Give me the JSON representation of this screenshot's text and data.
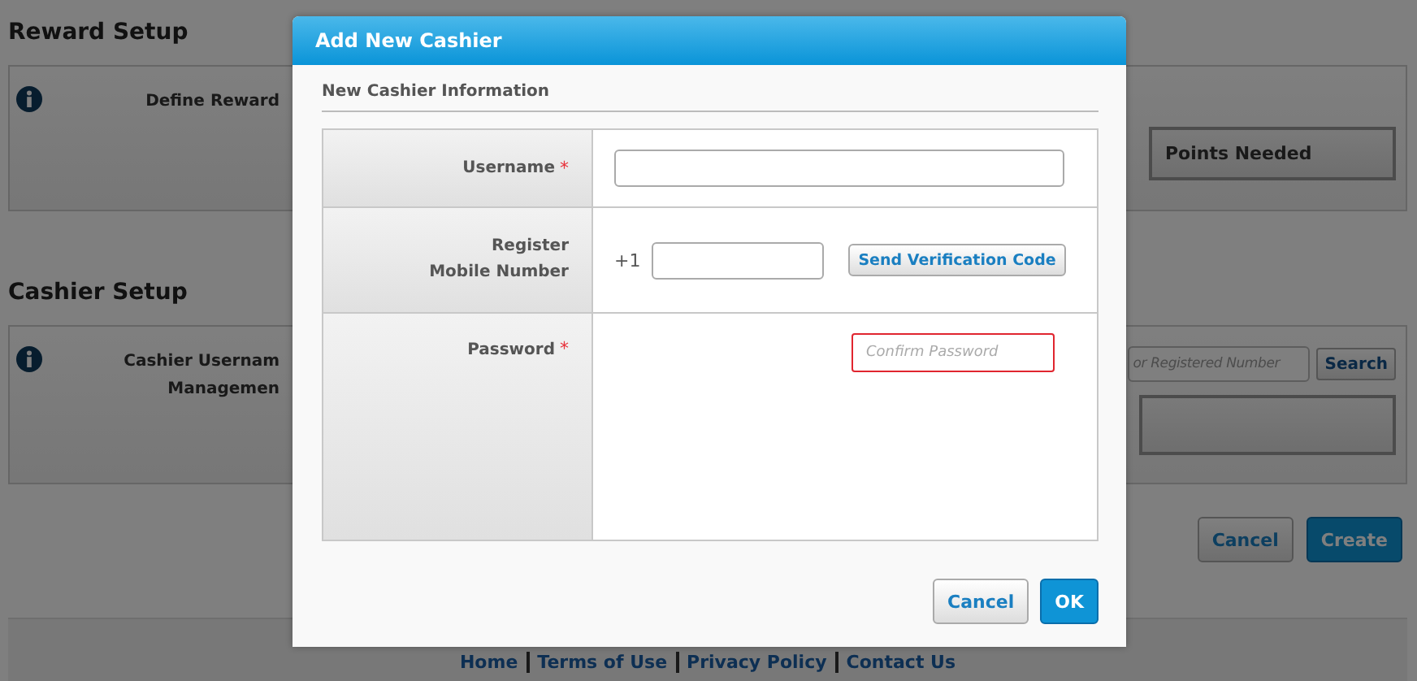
{
  "page": {
    "sections": [
      {
        "title": "Reward Setup",
        "label_lines": [
          "Define Reward"
        ],
        "column_header": "Points Needed"
      },
      {
        "title": "Cashier Setup",
        "label_lines": [
          "Cashier Usernam",
          "Managemen"
        ],
        "search": {
          "placeholder": "or Registered Number",
          "button": "Search"
        }
      }
    ],
    "actions": [
      {
        "label": "Cancel",
        "kind": "secondary"
      },
      {
        "label": "Create",
        "kind": "primary"
      }
    ],
    "footer_links": [
      "Home",
      "Terms of Use",
      "Privacy Policy",
      "Contact Us"
    ]
  },
  "dialog": {
    "title": "Add New Cashier",
    "section": "New Cashier Information",
    "fields": [
      {
        "kind": "text",
        "label_lines": [
          "Username"
        ],
        "required_mark": "*"
      },
      {
        "kind": "phone",
        "label_lines": [
          "Register",
          "Mobile Number"
        ],
        "prefix": "+1",
        "button": "Send Verification Code"
      },
      {
        "kind": "password",
        "label_lines": [
          "Password"
        ],
        "required_mark": "*",
        "confirm_placeholder": "Confirm Password",
        "invalid": true
      }
    ],
    "buttons": [
      {
        "label": "Cancel",
        "kind": "secondary"
      },
      {
        "label": "OK",
        "kind": "primary"
      }
    ]
  }
}
